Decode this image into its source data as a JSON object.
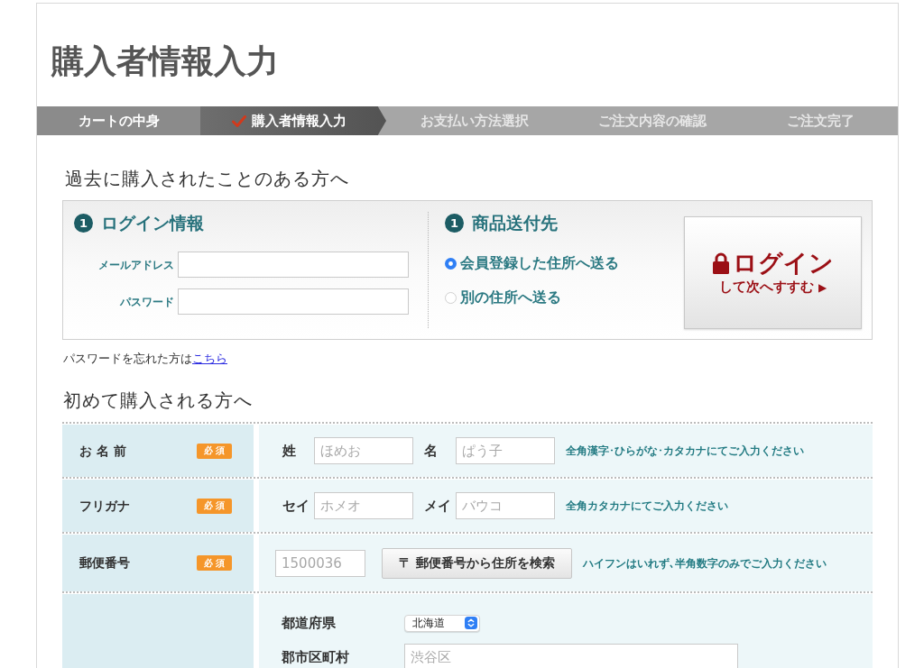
{
  "page_title": "購入者情報入力",
  "steps": [
    {
      "label": "カートの中身",
      "selected": false
    },
    {
      "label": "購入者情報入力",
      "selected": true
    },
    {
      "label": "お支払い方法選択",
      "selected": false
    },
    {
      "label": "ご注文内容の確認",
      "selected": false
    },
    {
      "label": "ご注文完了",
      "selected": false
    }
  ],
  "returning_customer": {
    "heading": "過去に購入されたことのある方へ",
    "login": {
      "number": "1",
      "heading": "ログイン情報",
      "fields": [
        {
          "label": "メールアドレス"
        },
        {
          "label": "パスワード"
        }
      ]
    },
    "shipping": {
      "number": "1",
      "heading": "商品送付先",
      "options": [
        {
          "label": "会員登録した住所へ送る",
          "selected": true
        },
        {
          "label": "別の住所へ送る",
          "selected": false
        }
      ]
    },
    "login_button": {
      "title": "ログイン",
      "subtitle": "して次へすすむ",
      "arrow": "▶"
    },
    "forgot_password": {
      "text": "パスワードを忘れた方は",
      "link": "こちら"
    }
  },
  "new_customer": {
    "heading": "初めて購入される方へ",
    "rows": [
      {
        "kind": "name",
        "label": "お 名 前",
        "badge": "必 須",
        "fields": [
          {
            "label": "姓",
            "placeholder": "ほめお"
          },
          {
            "label": "名",
            "placeholder": "ぱう子"
          }
        ],
        "hint": "全角漢字･ひらがな･カタカナにてご入力ください"
      },
      {
        "kind": "name",
        "label": "フリガナ",
        "badge": "必 須",
        "fields": [
          {
            "label": "セイ",
            "placeholder": "ホメオ"
          },
          {
            "label": "メイ",
            "placeholder": "バウコ"
          }
        ],
        "hint": "全角カタカナにてご入力ください"
      },
      {
        "kind": "postal",
        "label": "郵便番号",
        "badge": "必 須",
        "field": {
          "placeholder": "1500036"
        },
        "button": "〒 郵便番号から住所を検索",
        "hint": "ハイフンはいれず､半角数字のみでご入力ください"
      },
      {
        "kind": "address",
        "fields": [
          {
            "kind": "select",
            "label": "都道府県",
            "value": "北海道"
          },
          {
            "kind": "text",
            "label": "郡市区町村",
            "placeholder": "渋谷区"
          }
        ]
      }
    ]
  }
}
